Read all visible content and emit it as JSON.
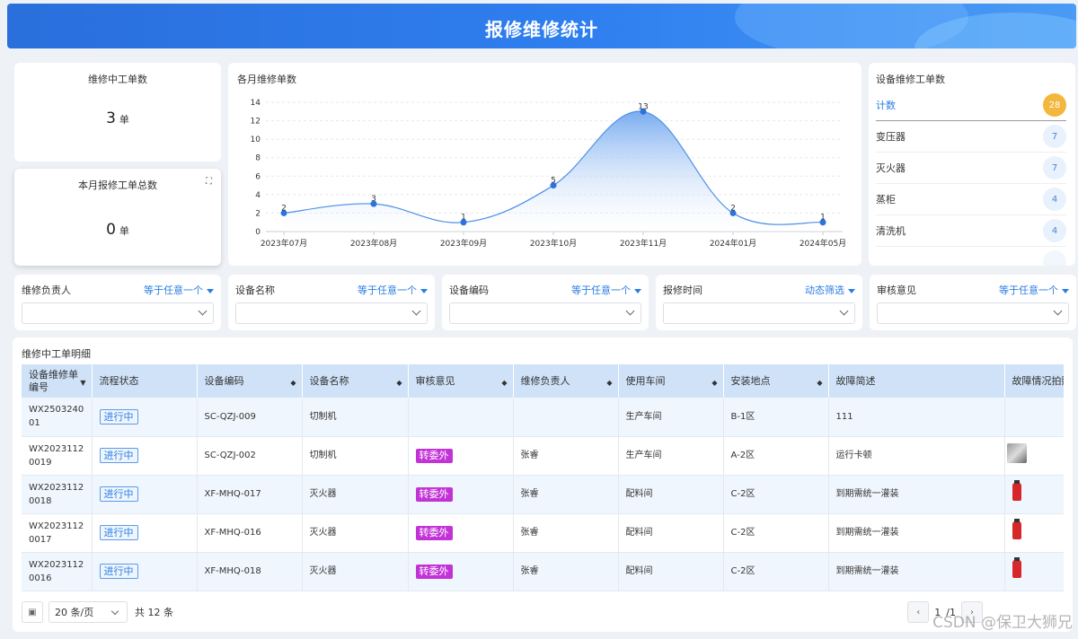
{
  "header": {
    "title": "报修维修统计"
  },
  "kpi_repairing": {
    "title": "维修中工单数",
    "value": "3",
    "unit": "单"
  },
  "kpi_month": {
    "title": "本月报修工单总数",
    "value": "0",
    "unit": "单",
    "expand_icon": "expand-icon"
  },
  "monthly_chart": {
    "title": "各月维修单数",
    "chart_data": {
      "type": "area",
      "categories": [
        "2023年07月",
        "2023年08月",
        "2023年09月",
        "2023年10月",
        "2023年11月",
        "2024年01月",
        "2024年05月"
      ],
      "series": [
        {
          "values": [
            2,
            3,
            1,
            5,
            13,
            2,
            1
          ]
        }
      ],
      "ylim": [
        0,
        14
      ],
      "yticks": [
        0,
        2,
        4,
        6,
        8,
        10,
        12,
        14
      ],
      "grid": true,
      "colors": {
        "line": "#4d8fe6",
        "fill_top": "#6aa3ee",
        "fill_bottom": "#ffffff",
        "point": "#2a74dd"
      }
    }
  },
  "device_counts": {
    "title": "设备维修工单数",
    "rows": [
      {
        "name": "计数",
        "count": "28",
        "active": true
      },
      {
        "name": "变压器",
        "count": "7"
      },
      {
        "name": "灭火器",
        "count": "7"
      },
      {
        "name": "蒸柜",
        "count": "4"
      },
      {
        "name": "清洗机",
        "count": "4"
      }
    ]
  },
  "filters": [
    {
      "label": "维修负责人",
      "op": "等于任意一个"
    },
    {
      "label": "设备名称",
      "op": "等于任意一个"
    },
    {
      "label": "设备编码",
      "op": "等于任意一个"
    },
    {
      "label": "报修时间",
      "op": "动态筛选"
    },
    {
      "label": "审核意见",
      "op": "等于任意一个"
    }
  ],
  "detail_table": {
    "title": "维修中工单明细",
    "columns": [
      "设备维修单编号",
      "流程状态",
      "设备编码",
      "设备名称",
      "审核意见",
      "维修负责人",
      "使用车间",
      "安装地点",
      "故障简述",
      "故障情况拍照"
    ],
    "rows": [
      {
        "id": "WX250324001",
        "status": "进行中",
        "code": "SC-QZJ-009",
        "name": "切制机",
        "review": "",
        "owner": "",
        "workshop": "生产车间",
        "location": "B-1区",
        "desc": "111",
        "photo": "none"
      },
      {
        "id": "WX20231120019",
        "status": "进行中",
        "code": "SC-QZJ-002",
        "name": "切制机",
        "review": "转委外",
        "owner": "张睿",
        "workshop": "生产车间",
        "location": "A-2区",
        "desc": "运行卡顿",
        "photo": "machine-photo"
      },
      {
        "id": "WX20231120018",
        "status": "进行中",
        "code": "XF-MHQ-017",
        "name": "灭火器",
        "review": "转委外",
        "owner": "张睿",
        "workshop": "配料间",
        "location": "C-2区",
        "desc": "到期需统一灌装",
        "photo": "extinguisher-photo"
      },
      {
        "id": "WX20231120017",
        "status": "进行中",
        "code": "XF-MHQ-016",
        "name": "灭火器",
        "review": "转委外",
        "owner": "张睿",
        "workshop": "配料间",
        "location": "C-2区",
        "desc": "到期需统一灌装",
        "photo": "extinguisher-photo"
      },
      {
        "id": "WX20231120016",
        "status": "进行中",
        "code": "XF-MHQ-018",
        "name": "灭火器",
        "review": "转委外",
        "owner": "张睿",
        "workshop": "配料间",
        "location": "C-2区",
        "desc": "到期需统一灌装",
        "photo": "extinguisher-photo"
      }
    ]
  },
  "pager": {
    "page_size": "20 条/页",
    "total": "共 12 条",
    "page": "1",
    "pages": "/1"
  },
  "watermark": "CSDN @保卫大狮兄"
}
